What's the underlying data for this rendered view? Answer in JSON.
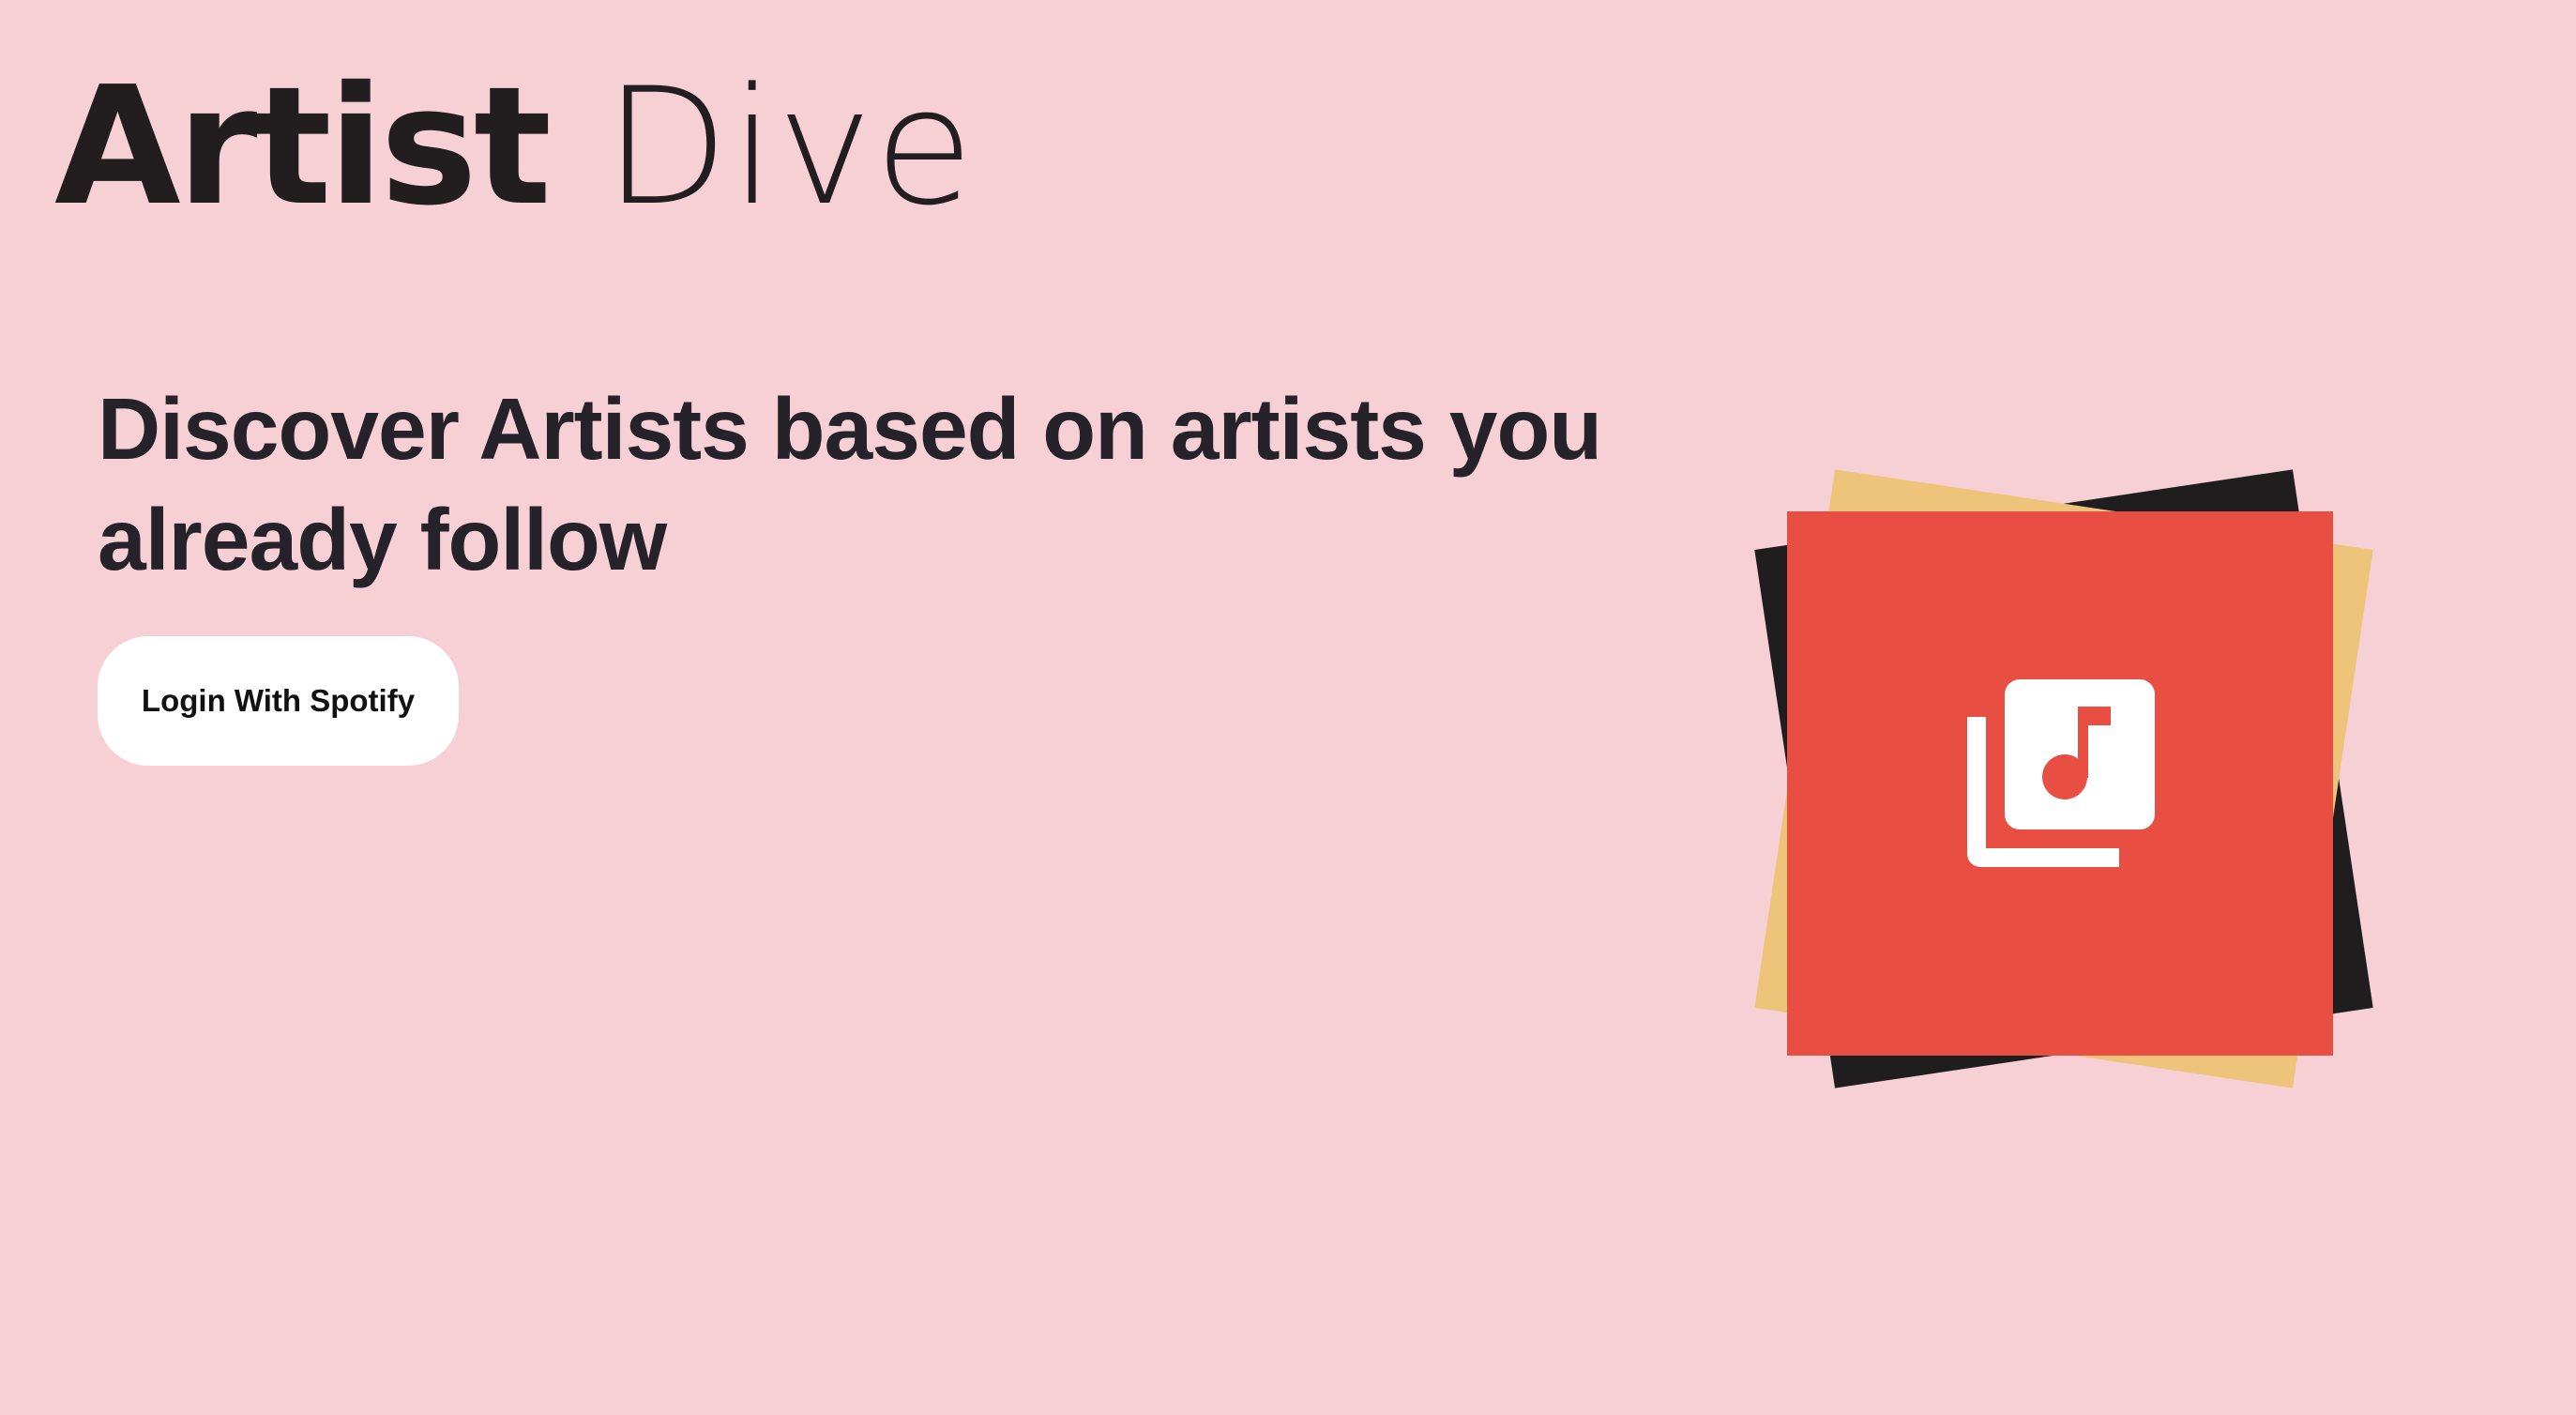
{
  "logo": {
    "bold": "Artist",
    "light": "Dive"
  },
  "hero": {
    "headline": "Discover Artists based on artists you already follow",
    "login_label": "Login With Spotify"
  },
  "illustration": {
    "icon": "library-music-icon",
    "colors": {
      "background": "#f7d0d6",
      "red": "#e84e41",
      "yellow": "#eec47a",
      "black": "#1f1d1e",
      "icon": "#ffffff"
    }
  }
}
